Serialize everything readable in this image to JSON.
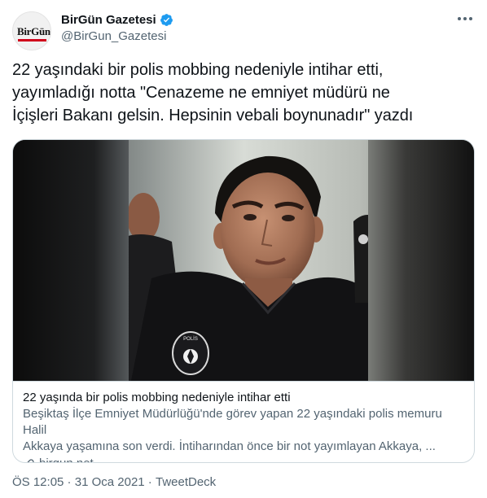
{
  "account": {
    "display_name": "BirGün Gazetesi",
    "handle": "@BirGun_Gazetesi",
    "avatar_text": "BirGün",
    "verified": true
  },
  "tweet": {
    "text_lines": [
      "22 yaşındaki bir polis mobbing nedeniyle intihar etti,",
      "yayımladığı notta \"Cenazeme ne emniyet müdürü ne",
      "İçişleri Bakanı gelsin. Hepsinin vebali boynunadır\" yazdı"
    ]
  },
  "card": {
    "title": "22 yaşında bir polis mobbing nedeniyle intihar etti",
    "description_lines": [
      "Beşiktaş İlçe Emniyet Müdürlüğü'nde görev yapan 22 yaşındaki polis memuru Halil",
      "Akkaya yaşamına son verdi. İntiharından önce bir not yayımlayan Akkaya, ..."
    ],
    "domain": "birgun.net",
    "badge_text": "POLİS"
  },
  "meta": {
    "time": "ÖS 12:05",
    "separator": " · ",
    "date": "31 Oca 2021",
    "source": "TweetDeck"
  },
  "colors": {
    "text_primary": "#0f1419",
    "text_secondary": "#536471",
    "verified_blue": "#1d9bf0",
    "border": "#cfd9de",
    "brand_red": "#d0021b"
  },
  "icons": {
    "verified": "verified-badge-icon",
    "more": "more-options-icon",
    "link": "link-icon"
  }
}
